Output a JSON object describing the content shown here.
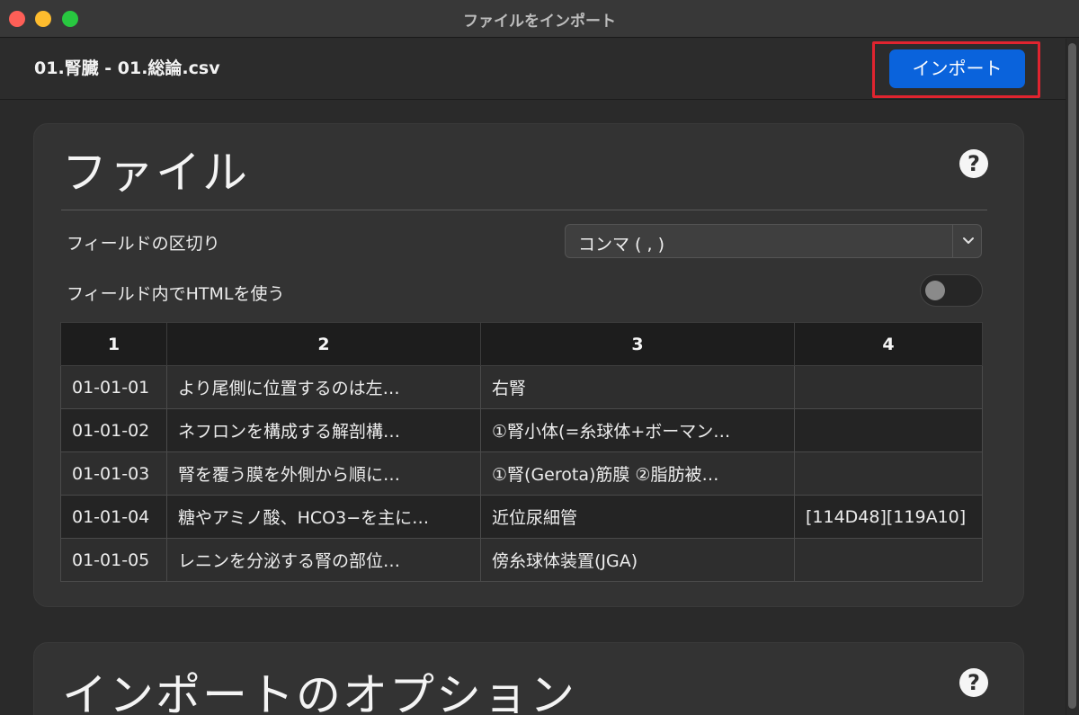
{
  "window": {
    "title": "ファイルをインポート"
  },
  "header": {
    "file_name": "01.腎臓 - 01.総論.csv",
    "import_label": "インポート"
  },
  "file_panel": {
    "title": "ファイル",
    "help_icon": "question-circle-icon",
    "separator_label": "フィールドの区切り",
    "separator_value": "コンマ ( , )",
    "html_label": "フィールド内でHTMLを使う",
    "html_toggle_on": false,
    "table": {
      "headers": [
        "1",
        "2",
        "3",
        "4"
      ],
      "rows": [
        [
          "01-01-01",
          "より尾側に位置するのは左…",
          "右腎",
          ""
        ],
        [
          "01-01-02",
          "ネフロンを構成する解剖構…",
          "①腎小体(=糸球体+ボーマン…",
          ""
        ],
        [
          "01-01-03",
          "腎を覆う膜を外側から順に…",
          "①腎(Gerota)筋膜 ②脂肪被…",
          ""
        ],
        [
          "01-01-04",
          "糖やアミノ酸、HCO3−を主に…",
          "近位尿細管",
          "[114D48][119A10]"
        ],
        [
          "01-01-05",
          "レニンを分泌する腎の部位…",
          "傍糸球体装置(JGA)",
          ""
        ]
      ]
    }
  },
  "options_panel": {
    "title": "インポートのオプション",
    "help_icon": "question-circle-icon"
  },
  "colors": {
    "accent": "#0a63dc",
    "highlight": "#e0242f"
  }
}
